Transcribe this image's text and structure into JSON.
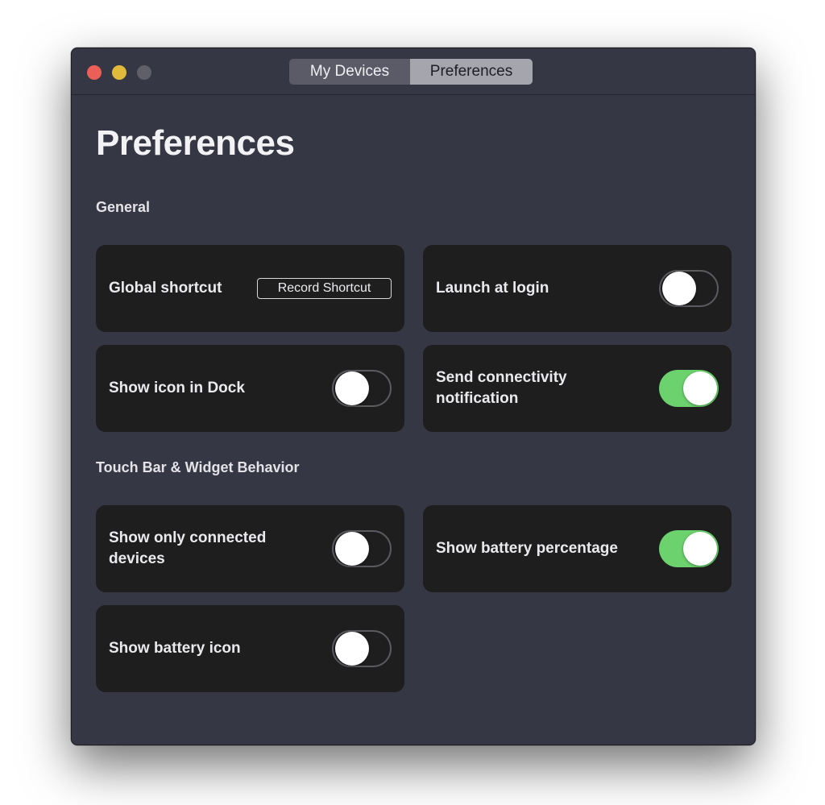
{
  "tabs": [
    {
      "label": "My Devices"
    },
    {
      "label": "Preferences"
    }
  ],
  "page_title": "Preferences",
  "sections": {
    "general": {
      "title": "General",
      "global_shortcut": {
        "label": "Global shortcut",
        "button_label": "Record Shortcut"
      },
      "launch_at_login": {
        "label": "Launch at login",
        "on": false
      },
      "show_icon_in_dock": {
        "label": "Show icon in Dock",
        "on": false
      },
      "send_connectivity_notification": {
        "label": "Send connectivity notification",
        "on": true
      }
    },
    "touchbar": {
      "title": "Touch Bar & Widget Behavior",
      "show_only_connected_devices": {
        "label": "Show only connected devices",
        "on": false
      },
      "show_battery_percentage": {
        "label": "Show battery percentage",
        "on": true
      },
      "show_battery_icon": {
        "label": "Show battery icon",
        "on": false
      }
    }
  },
  "colors": {
    "window_bg": "#363744",
    "card_bg": "#1e1e1f",
    "toggle_on": "#6bd26d",
    "close": "#ec5f57",
    "minimize": "#e0bb3b",
    "zoom_disabled": "#5e5f69"
  }
}
